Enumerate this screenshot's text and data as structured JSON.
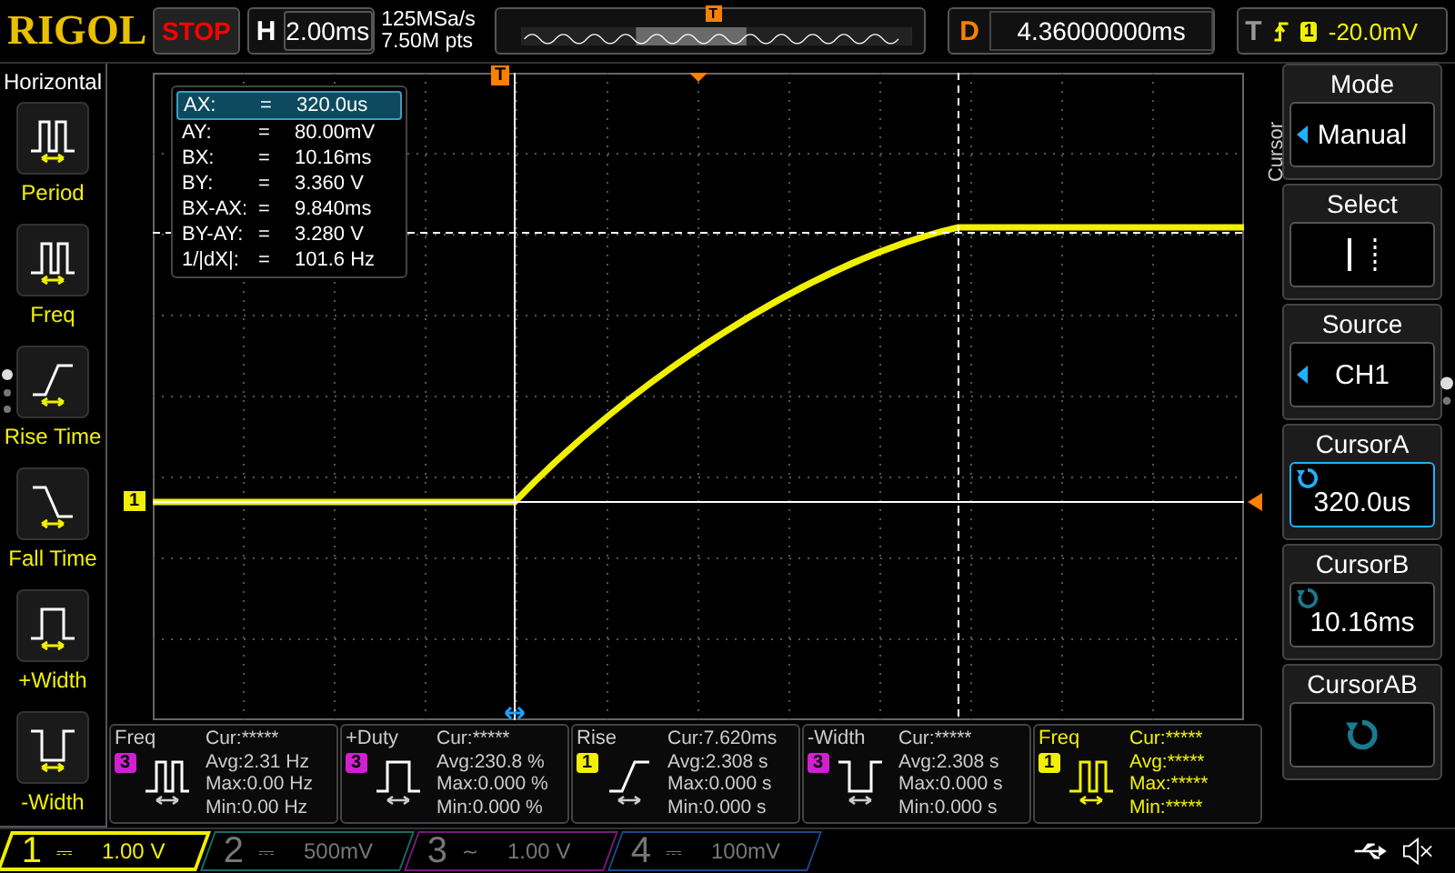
{
  "header": {
    "brand": "RIGOL",
    "run_state": "STOP",
    "timebase_label": "H",
    "timebase": "2.00ms",
    "sample_rate": "125MSa/s",
    "memory_depth": "7.50M pts",
    "delay_label": "D",
    "delay": "4.36000000ms",
    "trigger_label": "T",
    "trigger_channel": "1",
    "trigger_level": "-20.0mV",
    "memory_marker": "T"
  },
  "left_menu": {
    "title": "Horizontal",
    "items": [
      {
        "label": "Period",
        "kind": "period"
      },
      {
        "label": "Freq",
        "kind": "freq"
      },
      {
        "label": "Rise Time",
        "kind": "rise"
      },
      {
        "label": "Fall Time",
        "kind": "fall"
      },
      {
        "label": "+Width",
        "kind": "pwidth"
      },
      {
        "label": "-Width",
        "kind": "nwidth"
      }
    ]
  },
  "markers": {
    "trigger_position": "T",
    "channel": "1"
  },
  "cursor_readout": [
    {
      "name": "AX:",
      "value": "320.0us",
      "selected": true
    },
    {
      "name": "AY:",
      "value": "80.00mV",
      "selected": false
    },
    {
      "name": "BX:",
      "value": "10.16ms",
      "selected": false
    },
    {
      "name": "BY:",
      "value": "3.360 V",
      "selected": false
    },
    {
      "name": "BX-AX:",
      "value": "9.840ms",
      "selected": false
    },
    {
      "name": "BY-AY:",
      "value": "3.280 V",
      "selected": false
    },
    {
      "name": "1/|dX|:",
      "value": "101.6 Hz",
      "selected": false
    }
  ],
  "equals_sign": "=",
  "measurements": [
    {
      "title": "Freq",
      "channel": "3",
      "color": "#d020d0",
      "kind": "freq",
      "selected": false,
      "lines": [
        "Cur:*****",
        "Avg:2.31 Hz",
        "Max:0.00 Hz",
        "Min:0.00 Hz"
      ]
    },
    {
      "title": "+Duty",
      "channel": "3",
      "color": "#d020d0",
      "kind": "pwidth",
      "selected": false,
      "lines": [
        "Cur:*****",
        "Avg:230.8 %",
        "Max:0.000 %",
        "Min:0.000 %"
      ]
    },
    {
      "title": "Rise",
      "channel": "1",
      "color": "#f0f000",
      "kind": "rise",
      "selected": false,
      "lines": [
        "Cur:7.620ms",
        "Avg:2.308 s",
        "Max:0.000 s",
        "Min:0.000 s"
      ]
    },
    {
      "title": "-Width",
      "channel": "3",
      "color": "#d020d0",
      "kind": "nwidth",
      "selected": false,
      "lines": [
        "Cur:*****",
        "Avg:2.308 s",
        "Max:0.000 s",
        "Min:0.000 s"
      ]
    },
    {
      "title": "Freq",
      "channel": "1",
      "color": "#f0f000",
      "kind": "freq",
      "selected": true,
      "lines": [
        "Cur:*****",
        "Avg:*****",
        "Max:*****",
        "Min:*****"
      ]
    }
  ],
  "right_menu": {
    "title": "Cursor",
    "items": [
      {
        "label": "Mode",
        "kind": "option",
        "value": "Manual",
        "selected": false
      },
      {
        "label": "Select",
        "kind": "select",
        "selected": false
      },
      {
        "label": "Source",
        "kind": "option",
        "value": "CH1",
        "selected": false
      },
      {
        "label": "CursorA",
        "kind": "knob",
        "value": "320.0us",
        "selected": true
      },
      {
        "label": "CursorB",
        "kind": "knob",
        "value": "10.16ms",
        "selected": false
      },
      {
        "label": "CursorAB",
        "kind": "knob",
        "selected": false
      }
    ]
  },
  "channels": [
    {
      "number": "1",
      "coupling": "⎓",
      "scale": "1.00 V",
      "on": true,
      "color": "#f0f000"
    },
    {
      "number": "2",
      "coupling": "⎓",
      "scale": "500mV",
      "on": false,
      "color": "#1a6a6a"
    },
    {
      "number": "3",
      "coupling": "~",
      "scale": "1.00 V",
      "on": false,
      "color": "#7a1a7a"
    },
    {
      "number": "4",
      "coupling": "⎓",
      "scale": "100mV",
      "on": false,
      "color": "#1a4a8a"
    }
  ]
}
